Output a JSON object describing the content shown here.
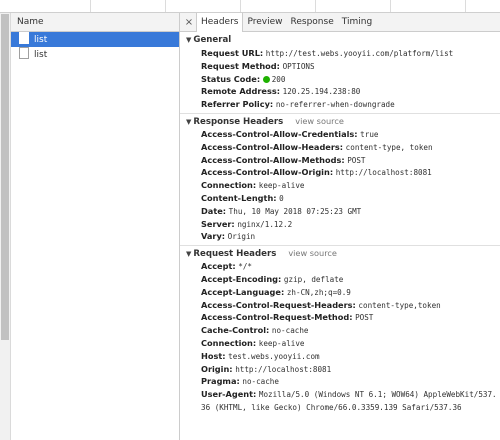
{
  "name_pane": {
    "header": "Name",
    "requests": [
      {
        "name": "list",
        "selected": true
      },
      {
        "name": "list",
        "selected": false
      }
    ]
  },
  "tabs": {
    "close_icon": "×",
    "items": [
      "Headers",
      "Preview",
      "Response",
      "Timing"
    ],
    "active": "Headers"
  },
  "general": {
    "title": "General",
    "rows": [
      {
        "key": "Request URL:",
        "value": "http://test.webs.yooyii.com/platform/list"
      },
      {
        "key": "Request Method:",
        "value": "OPTIONS"
      },
      {
        "key": "Status Code:",
        "value": "200"
      },
      {
        "key": "Remote Address:",
        "value": "120.25.194.238:80"
      },
      {
        "key": "Referrer Policy:",
        "value": "no-referrer-when-downgrade"
      }
    ]
  },
  "response_headers": {
    "title": "Response Headers",
    "view_source": "view source",
    "rows": [
      {
        "key": "Access-Control-Allow-Credentials:",
        "value": "true"
      },
      {
        "key": "Access-Control-Allow-Headers:",
        "value": "content-type, token"
      },
      {
        "key": "Access-Control-Allow-Methods:",
        "value": "POST"
      },
      {
        "key": "Access-Control-Allow-Origin:",
        "value": "http://localhost:8081"
      },
      {
        "key": "Connection:",
        "value": "keep-alive"
      },
      {
        "key": "Content-Length:",
        "value": "0"
      },
      {
        "key": "Date:",
        "value": "Thu, 10 May 2018 07:25:23 GMT"
      },
      {
        "key": "Server:",
        "value": "nginx/1.12.2"
      },
      {
        "key": "Vary:",
        "value": "Origin"
      }
    ]
  },
  "request_headers": {
    "title": "Request Headers",
    "view_source": "view source",
    "rows": [
      {
        "key": "Accept:",
        "value": "*/*"
      },
      {
        "key": "Accept-Encoding:",
        "value": "gzip, deflate"
      },
      {
        "key": "Accept-Language:",
        "value": "zh-CN,zh;q=0.9"
      },
      {
        "key": "Access-Control-Request-Headers:",
        "value": "content-type,token"
      },
      {
        "key": "Access-Control-Request-Method:",
        "value": "POST"
      },
      {
        "key": "Cache-Control:",
        "value": "no-cache"
      },
      {
        "key": "Connection:",
        "value": "keep-alive"
      },
      {
        "key": "Host:",
        "value": "test.webs.yooyii.com"
      },
      {
        "key": "Origin:",
        "value": "http://localhost:8081"
      },
      {
        "key": "Pragma:",
        "value": "no-cache"
      },
      {
        "key": "User-Agent:",
        "value": "Mozilla/5.0 (Windows NT 6.1; WOW64) AppleWebKit/537."
      }
    ],
    "continuation": "36 (KHTML, like Gecko) Chrome/66.0.3359.139 Safari/537.36"
  },
  "colors": {
    "selection": "#3879d9",
    "status_ok": "#1eb100"
  }
}
